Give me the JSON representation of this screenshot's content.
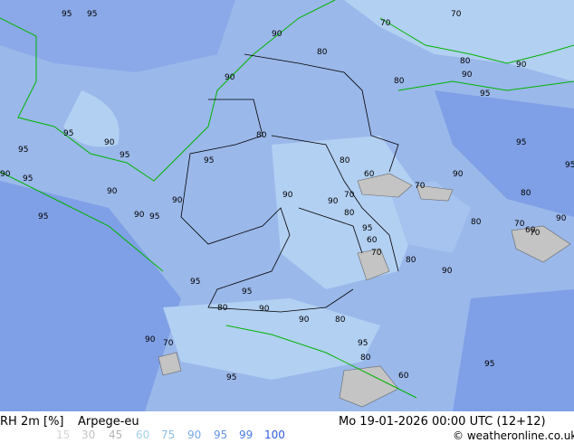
{
  "map": {
    "parameter": "RH 2m [%]",
    "model": "Arpege-eu",
    "valid_time": "Mo 19-01-2026 00:00 UTC (12+12)",
    "credit": "© weatheronline.co.uk",
    "colors": {
      "base": "#9ab8ea",
      "light": "#b2d0f2",
      "dark": "#7f9fe6",
      "gray": "#c4c4c4",
      "border": "#000000",
      "coast": "#00b400"
    },
    "contour_labels": [
      "95",
      "95",
      "90",
      "80",
      "70",
      "70",
      "90",
      "80",
      "90",
      "80",
      "90",
      "95",
      "95",
      "90",
      "95",
      "95",
      "90",
      "95",
      "90",
      "90",
      "95",
      "95",
      "90",
      "80",
      "60",
      "70",
      "80",
      "70",
      "90",
      "80",
      "60",
      "70",
      "80",
      "90",
      "95",
      "80",
      "70",
      "70",
      "60",
      "90",
      "95",
      "80",
      "90",
      "95",
      "95",
      "90",
      "80",
      "80",
      "95",
      "90",
      "95",
      "60",
      "95",
      "80",
      "90",
      "95",
      "70",
      "95",
      "90"
    ]
  },
  "legend": [
    {
      "value": "15",
      "color": "#d2d2d2"
    },
    {
      "value": "30",
      "color": "#c3c3c3"
    },
    {
      "value": "45",
      "color": "#b4b4b4"
    },
    {
      "value": "60",
      "color": "#a6d0ea"
    },
    {
      "value": "75",
      "color": "#8cbee6"
    },
    {
      "value": "90",
      "color": "#78a8e6"
    },
    {
      "value": "95",
      "color": "#6496e6"
    },
    {
      "value": "99",
      "color": "#4b7ee6"
    },
    {
      "value": "100",
      "color": "#325ae6"
    }
  ]
}
